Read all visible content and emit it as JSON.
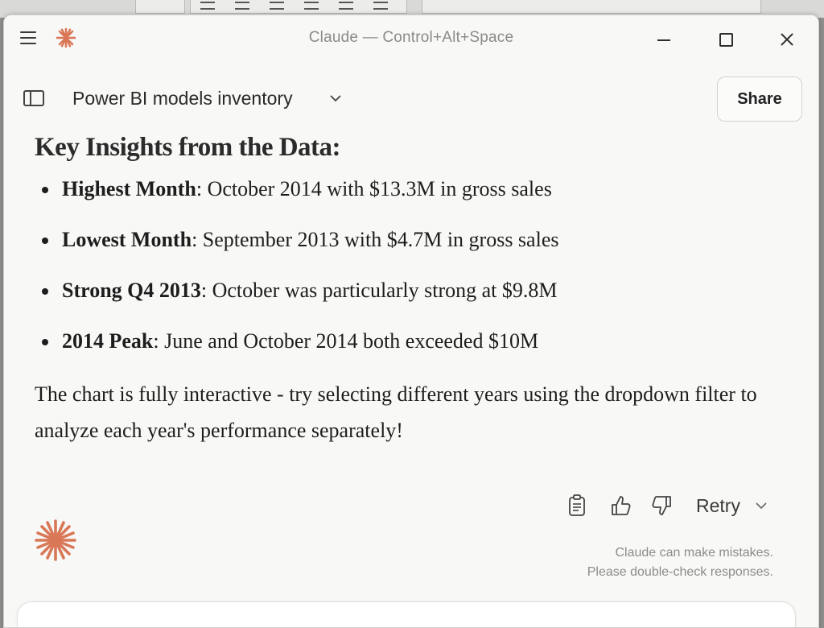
{
  "window": {
    "title": "Claude — Control+Alt+Space"
  },
  "header": {
    "chat_title": "Power BI models inventory",
    "share_label": "Share"
  },
  "message": {
    "heading": "Key Insights from the Data:",
    "insights": [
      {
        "label": "Highest Month",
        "text": ": October 2014 with $13.3M in gross sales"
      },
      {
        "label": "Lowest Month",
        "text": ": September 2013 with $4.7M in gross sales"
      },
      {
        "label": "Strong Q4 2013",
        "text": ": October was particularly strong at $9.8M"
      },
      {
        "label": "2014 Peak",
        "text": ": June and October 2014 both exceeded $10M"
      }
    ],
    "paragraph": "The chart is fully interactive - try selecting different years using the dropdown filter to analyze each year's performance separately!"
  },
  "actions": {
    "retry_label": "Retry",
    "icons": [
      "copy-icon",
      "thumbs-up-icon",
      "thumbs-down-icon",
      "chevron-down-icon"
    ]
  },
  "footer": {
    "disclaimer_line1": "Claude can make mistakes.",
    "disclaimer_line2": "Please double-check responses."
  },
  "colors": {
    "accent": "#d97757",
    "background": "#f8f8f6",
    "text": "#1d1d1d",
    "muted": "#8b8b89"
  }
}
